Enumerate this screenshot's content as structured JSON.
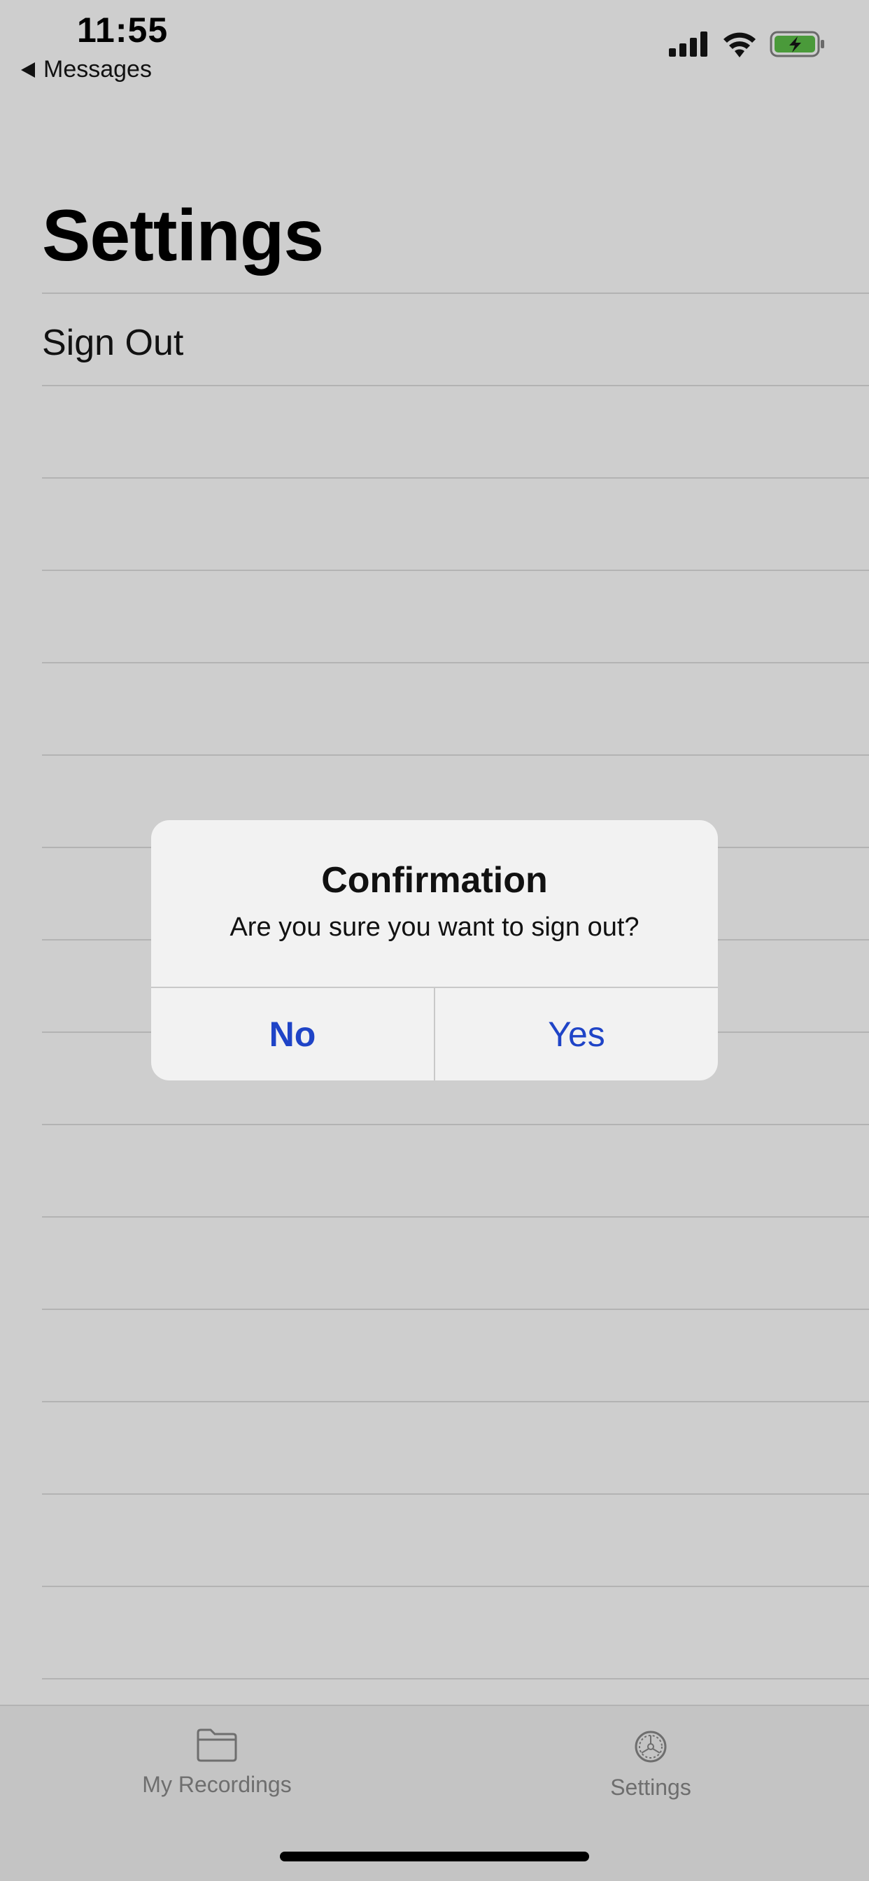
{
  "status_bar": {
    "time": "11:55",
    "back_label": "Messages",
    "icons": [
      "cellular-signal-icon",
      "wifi-icon",
      "battery-charging-icon"
    ]
  },
  "page": {
    "title": "Settings"
  },
  "settings_list": {
    "items": [
      {
        "label": "Sign Out"
      }
    ]
  },
  "alert": {
    "title": "Confirmation",
    "message": "Are you sure you want to sign out?",
    "no_label": "No",
    "yes_label": "Yes"
  },
  "tab_bar": {
    "tabs": [
      {
        "label": "My Recordings",
        "icon": "folder-icon"
      },
      {
        "label": "Settings",
        "icon": "gear-icon"
      }
    ]
  },
  "colors": {
    "background": "#cecece",
    "alert_button": "#1f44c7",
    "battery_fill": "#4a9a3a"
  }
}
